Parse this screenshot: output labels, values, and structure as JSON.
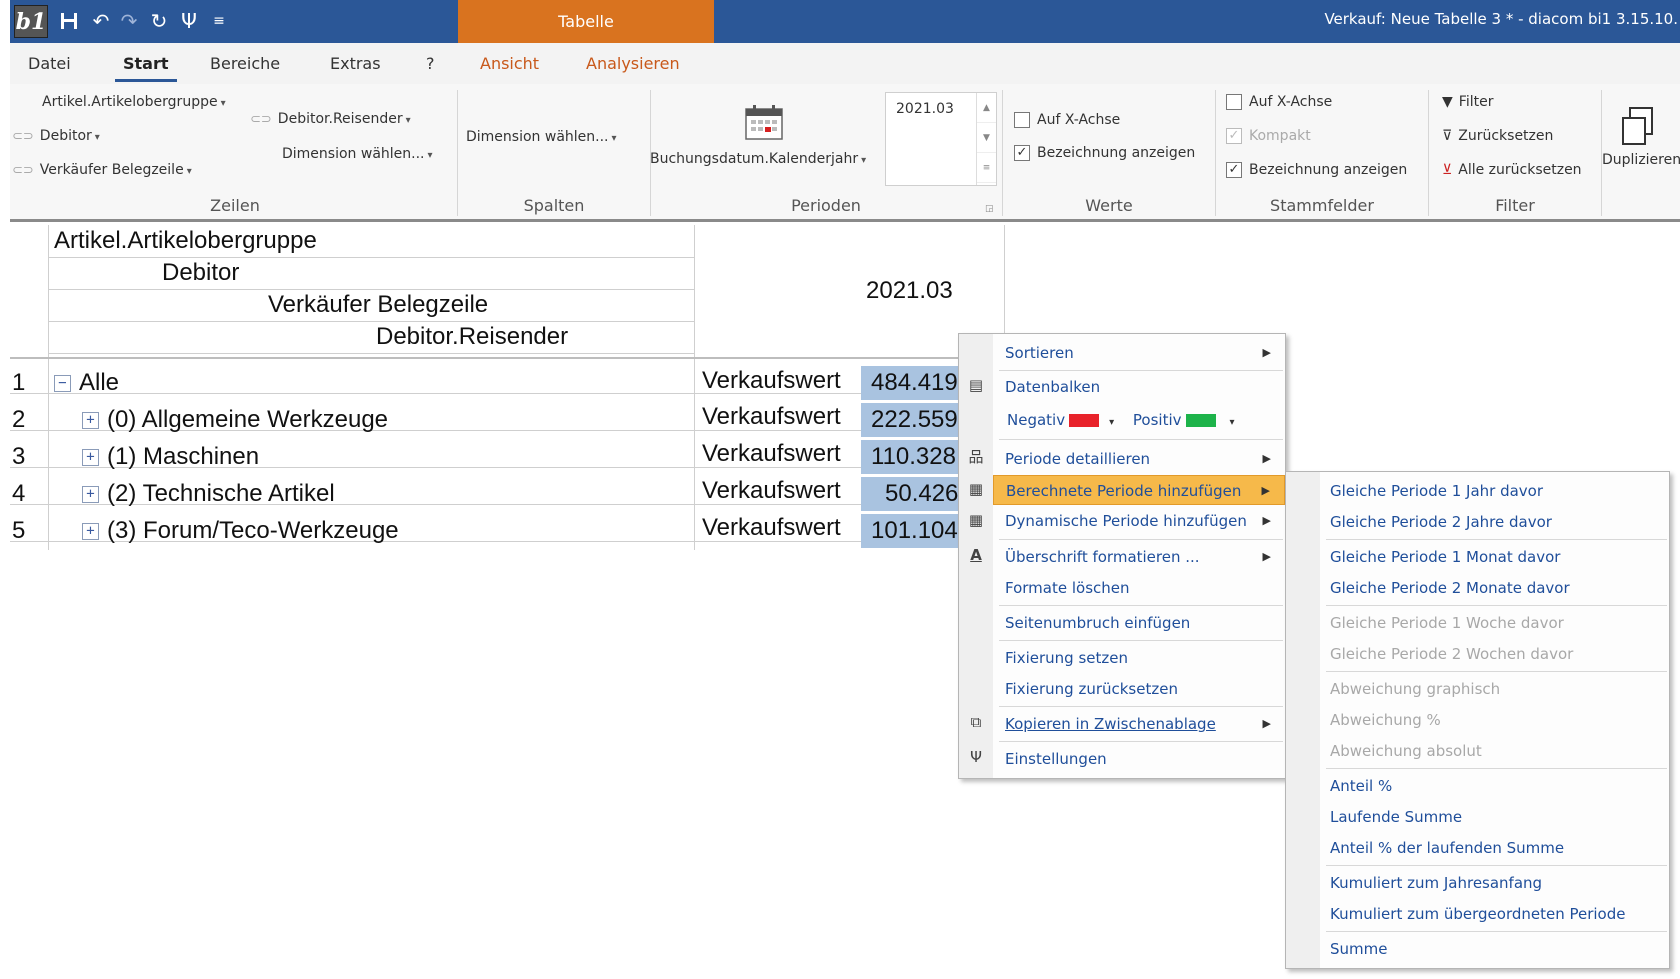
{
  "titlebar": {
    "logo_text": "b1",
    "context_tab": "Tabelle",
    "window_title": "Verkauf: Neue Tabelle 3 * - diacom bi1 3.15.10."
  },
  "tabs": [
    "Datei",
    "Start",
    "Bereiche",
    "Extras",
    "?",
    "Ansicht",
    "Analysieren"
  ],
  "ribbon": {
    "zeilen": {
      "items": [
        "Artikel.Artikelobergruppe",
        "Debitor",
        "Verkäufer Belegzeile",
        "Debitor.Reisender",
        "Dimension wählen..."
      ],
      "label": "Zeilen"
    },
    "spalten": {
      "button": "Dimension wählen...",
      "label": "Spalten"
    },
    "perioden": {
      "button": "Buchungsdatum.Kalenderjahr",
      "value": "2021.03",
      "label": "Perioden"
    },
    "werte": {
      "x_achse": "Auf X-Achse",
      "bezeichnung": "Bezeichnung anzeigen",
      "label": "Werte"
    },
    "stammfelder": {
      "x_achse": "Auf X-Achse",
      "kompakt": "Kompakt",
      "bezeichnung": "Bezeichnung anzeigen",
      "label": "Stammfelder"
    },
    "filter": {
      "filter": "Filter",
      "reset": "Zurücksetzen",
      "reset_all": "Alle zurücksetzen",
      "label": "Filter"
    },
    "duplizieren": "Duplizieren"
  },
  "table": {
    "headers": [
      "Artikel.Artikelobergruppe",
      "Debitor",
      "Verkäufer Belegzeile",
      "Debitor.Reisender"
    ],
    "period": "2021.03",
    "rows": [
      {
        "num": "1",
        "label": "Alle",
        "sign": "−",
        "measure": "Verkaufswert",
        "value": "484.419"
      },
      {
        "num": "2",
        "label": "(0) Allgemeine Werkzeuge",
        "sign": "+",
        "measure": "Verkaufswert",
        "value": "222.559"
      },
      {
        "num": "3",
        "label": "(1) Maschinen",
        "sign": "+",
        "measure": "Verkaufswert",
        "value": "110.328"
      },
      {
        "num": "4",
        "label": "(2) Technische Artikel",
        "sign": "+",
        "measure": "Verkaufswert",
        "value": "50.426"
      },
      {
        "num": "5",
        "label": "(3) Forum/Teco-Werkzeuge",
        "sign": "+",
        "measure": "Verkaufswert",
        "value": "101.104"
      }
    ]
  },
  "context_menu": {
    "items": [
      "Sortieren",
      "Datenbalken",
      "Negativ",
      "Positiv",
      "Periode detaillieren",
      "Berechnete Periode hinzufügen",
      "Dynamische Periode hinzufügen",
      "Überschrift formatieren ...",
      "Formate löschen",
      "Seitenumbruch einfügen",
      "Fixierung setzen",
      "Fixierung zurücksetzen",
      "Kopieren in Zwischenablage",
      "Einstellungen"
    ],
    "negativ_color": "#e8222a",
    "positiv_color": "#1db34a"
  },
  "submenu": {
    "items": [
      "Gleiche Periode 1 Jahr davor",
      "Gleiche Periode 2 Jahre davor",
      "Gleiche Periode 1 Monat davor",
      "Gleiche Periode 2 Monate davor",
      "Gleiche Periode 1 Woche davor",
      "Gleiche Periode 2 Wochen davor",
      "Abweichung graphisch",
      "Abweichung %",
      "Abweichung absolut",
      "Anteil %",
      "Laufende Summe",
      "Anteil % der laufenden Summe",
      "Kumuliert zum Jahresanfang",
      "Kumuliert zum übergeordneten Periode",
      "Summe"
    ]
  }
}
